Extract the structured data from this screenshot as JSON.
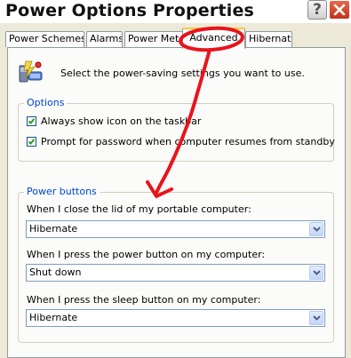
{
  "window": {
    "title": "Power Options Properties",
    "help_glyph": "?"
  },
  "tabs": [
    {
      "label": "Power Schemes",
      "active": false
    },
    {
      "label": "Alarms",
      "active": false
    },
    {
      "label": "Power Meter",
      "active": false
    },
    {
      "label": "Advanced",
      "active": true
    },
    {
      "label": "Hibernate",
      "active": false
    }
  ],
  "intro": {
    "icon": "power-settings-icon",
    "text": "Select the power-saving settings you want to use."
  },
  "options": {
    "title": "Options",
    "items": [
      {
        "label": "Always show icon on the taskbar",
        "checked": true
      },
      {
        "label": "Prompt for password when computer resumes from standby",
        "checked": true
      }
    ]
  },
  "power_buttons": {
    "title": "Power buttons",
    "fields": [
      {
        "label": "When I close the lid of my portable computer:",
        "value": "Hibernate"
      },
      {
        "label": "When I press the power button on my computer:",
        "value": "Shut down"
      },
      {
        "label": "When I press the sleep button on my computer:",
        "value": "Hibernate"
      }
    ]
  },
  "colors": {
    "annotation": "#e8141c",
    "group_title": "#0046d5",
    "active_tab_highlight": "#ffc83c"
  }
}
